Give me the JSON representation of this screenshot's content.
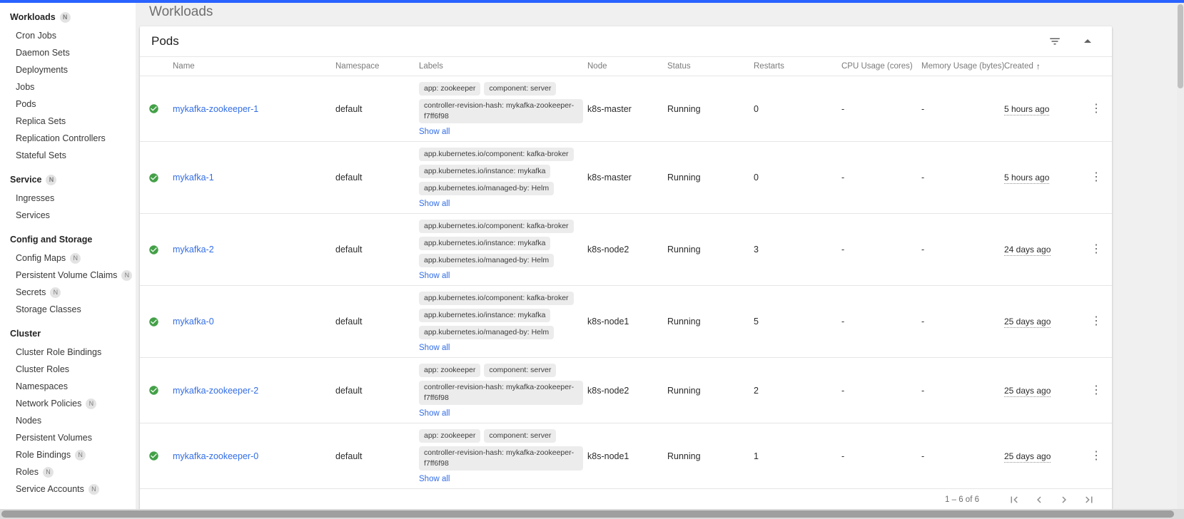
{
  "colors": {
    "accent": "#2962ff",
    "link": "#326de6",
    "success": "#43a047",
    "chip_bg": "#ececec"
  },
  "icons": {
    "row_menu_glyph": "⋮",
    "sort_asc_glyph": "↑",
    "namespaced_badge_letter": "N"
  },
  "page": {
    "title": "Workloads"
  },
  "sidebar": {
    "sections": [
      {
        "label": "Workloads",
        "badge": "N",
        "items": [
          {
            "label": "Cron Jobs"
          },
          {
            "label": "Daemon Sets"
          },
          {
            "label": "Deployments"
          },
          {
            "label": "Jobs"
          },
          {
            "label": "Pods",
            "active": true
          },
          {
            "label": "Replica Sets"
          },
          {
            "label": "Replication Controllers"
          },
          {
            "label": "Stateful Sets"
          }
        ]
      },
      {
        "label": "Service",
        "badge": "N",
        "items": [
          {
            "label": "Ingresses"
          },
          {
            "label": "Services"
          }
        ]
      },
      {
        "label": "Config and Storage",
        "items": [
          {
            "label": "Config Maps",
            "badge": "N"
          },
          {
            "label": "Persistent Volume Claims",
            "badge": "N"
          },
          {
            "label": "Secrets",
            "badge": "N"
          },
          {
            "label": "Storage Classes"
          }
        ]
      },
      {
        "label": "Cluster",
        "items": [
          {
            "label": "Cluster Role Bindings"
          },
          {
            "label": "Cluster Roles"
          },
          {
            "label": "Namespaces"
          },
          {
            "label": "Network Policies",
            "badge": "N"
          },
          {
            "label": "Nodes"
          },
          {
            "label": "Persistent Volumes"
          },
          {
            "label": "Role Bindings",
            "badge": "N"
          },
          {
            "label": "Roles",
            "badge": "N"
          },
          {
            "label": "Service Accounts",
            "badge": "N"
          }
        ]
      }
    ]
  },
  "card": {
    "title": "Pods",
    "table": {
      "columns": {
        "name": "Name",
        "namespace": "Namespace",
        "labels": "Labels",
        "node": "Node",
        "status": "Status",
        "restarts": "Restarts",
        "cpu": "CPU Usage (cores)",
        "memory": "Memory Usage (bytes)",
        "created": "Created"
      },
      "show_all_label": "Show all",
      "rows": [
        {
          "name": "mykafka-zookeeper-1",
          "namespace": "default",
          "labels": [
            "app: zookeeper",
            "component: server",
            "controller-revision-hash: mykafka-zookeeper-f7ff6f98"
          ],
          "node": "k8s-master",
          "status": "Running",
          "restarts": "0",
          "cpu": "-",
          "memory": "-",
          "created": "5 hours ago"
        },
        {
          "name": "mykafka-1",
          "namespace": "default",
          "labels": [
            "app.kubernetes.io/component: kafka-broker",
            "app.kubernetes.io/instance: mykafka",
            "app.kubernetes.io/managed-by: Helm"
          ],
          "node": "k8s-master",
          "status": "Running",
          "restarts": "0",
          "cpu": "-",
          "memory": "-",
          "created": "5 hours ago"
        },
        {
          "name": "mykafka-2",
          "namespace": "default",
          "labels": [
            "app.kubernetes.io/component: kafka-broker",
            "app.kubernetes.io/instance: mykafka",
            "app.kubernetes.io/managed-by: Helm"
          ],
          "node": "k8s-node2",
          "status": "Running",
          "restarts": "3",
          "cpu": "-",
          "memory": "-",
          "created": "24 days ago"
        },
        {
          "name": "mykafka-0",
          "namespace": "default",
          "labels": [
            "app.kubernetes.io/component: kafka-broker",
            "app.kubernetes.io/instance: mykafka",
            "app.kubernetes.io/managed-by: Helm"
          ],
          "node": "k8s-node1",
          "status": "Running",
          "restarts": "5",
          "cpu": "-",
          "memory": "-",
          "created": "25 days ago"
        },
        {
          "name": "mykafka-zookeeper-2",
          "namespace": "default",
          "labels": [
            "app: zookeeper",
            "component: server",
            "controller-revision-hash: mykafka-zookeeper-f7ff6f98"
          ],
          "node": "k8s-node2",
          "status": "Running",
          "restarts": "2",
          "cpu": "-",
          "memory": "-",
          "created": "25 days ago"
        },
        {
          "name": "mykafka-zookeeper-0",
          "namespace": "default",
          "labels": [
            "app: zookeeper",
            "component: server",
            "controller-revision-hash: mykafka-zookeeper-f7ff6f98"
          ],
          "node": "k8s-node1",
          "status": "Running",
          "restarts": "1",
          "cpu": "-",
          "memory": "-",
          "created": "25 days ago"
        }
      ]
    },
    "pagination": {
      "range_label": "1 – 6 of 6"
    }
  }
}
